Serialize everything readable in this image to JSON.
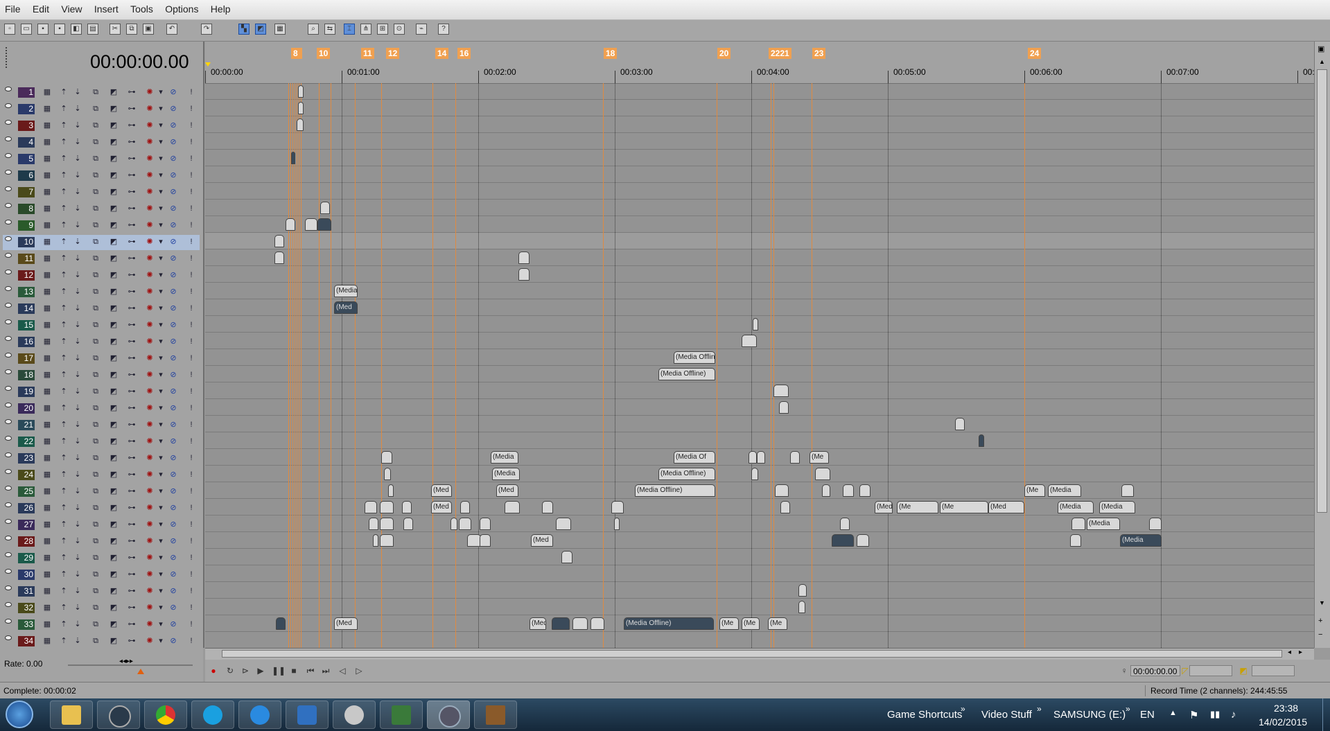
{
  "menu": [
    "File",
    "Edit",
    "View",
    "Insert",
    "Tools",
    "Options",
    "Help"
  ],
  "timecode": "00:00:00.00",
  "tracks": [
    "1",
    "2",
    "3",
    "4",
    "5",
    "6",
    "7",
    "8",
    "9",
    "10",
    "11",
    "12",
    "13",
    "14",
    "15",
    "16",
    "17",
    "18",
    "19",
    "20",
    "21",
    "22",
    "23",
    "24",
    "25",
    "26",
    "27",
    "28",
    "29",
    "30",
    "31",
    "32",
    "33",
    "34"
  ],
  "track_colors": [
    "#4a2a5a",
    "#2a3a6a",
    "#6a1a1a",
    "#2a3a5a",
    "#2a3a6a",
    "#1e3a4a",
    "#4a4a1a",
    "#2a4a2a",
    "#2a5a2a",
    "#2a3a5a",
    "#5a4a1a",
    "#6a1a1a",
    "#2a5a3a",
    "#2a3a5a",
    "#1a5a4a",
    "#2a3a5a",
    "#5a4a1a",
    "#2a4a3a",
    "#2a3a5a",
    "#3a2a5a",
    "#2a4a5a",
    "#1a5a4a",
    "#2a3a5a",
    "#4a4a1a",
    "#2a5a3a",
    "#2a3a5a",
    "#3a2a5a",
    "#6a1a1a",
    "#1a5a4a",
    "#2a3a6a",
    "#2a3a5a",
    "#4a4a1a",
    "#2a5a3a",
    "#6a1a1a"
  ],
  "ruler_labels": [
    "00:00:00",
    "00:01:00",
    "00:02:00",
    "00:03:00",
    "00:04:00",
    "00:05:00",
    "00:06:00",
    "00:07:00",
    "00:0"
  ],
  "markers": [
    "8",
    "10",
    "11",
    "12",
    "14",
    "16",
    "18",
    "20",
    "2221",
    "23",
    "24"
  ],
  "clip_labels": {
    "media": "(Media",
    "media_offline": "(Media Offline)",
    "media_of": "(Media Of",
    "med": "(Med",
    "me": "(Me"
  },
  "rate_label": "Rate: 0.00",
  "transport_timecode": "00:00:00.00",
  "status_left": "Complete: 00:00:02",
  "status_right": "Record Time (2 channels): 244:45:55",
  "taskbar": {
    "tray_items": [
      "Game Shortcuts",
      "Video Stuff",
      "SAMSUNG (E:)"
    ],
    "lang": "EN",
    "time": "23:38",
    "date": "14/02/2015"
  },
  "colors": {
    "marker": "#f0a050",
    "selected_track": "#aebfd8",
    "taskbar": "#1e3448"
  }
}
